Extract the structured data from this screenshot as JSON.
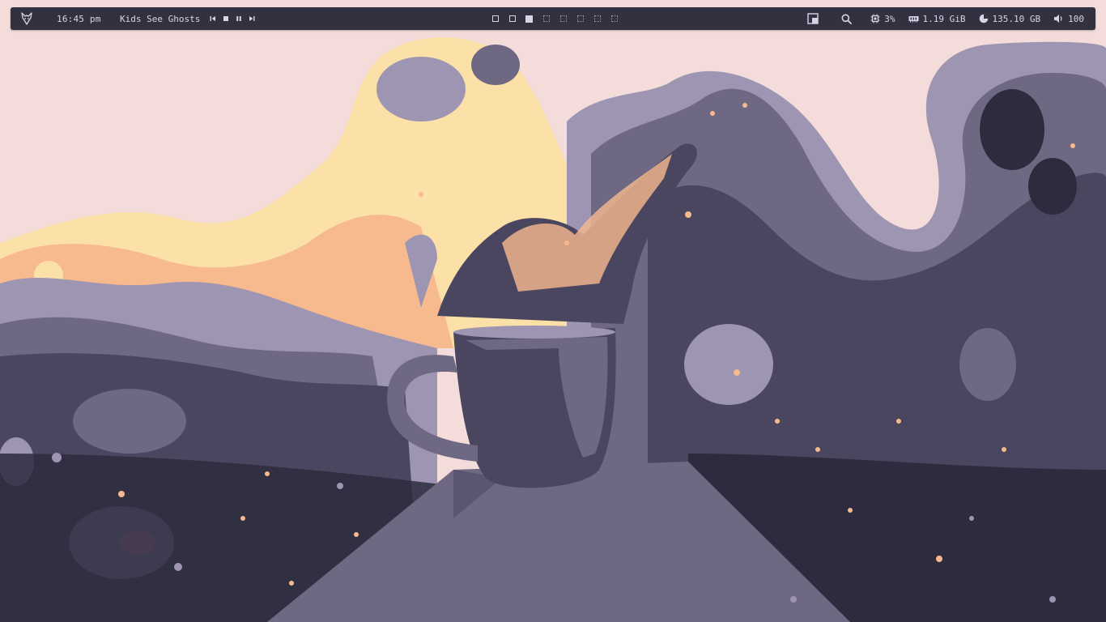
{
  "topbar": {
    "logo_icon": "wolf-logo-icon",
    "clock": "16:45 pm",
    "media": {
      "title": "Kids See Ghosts",
      "controls": [
        {
          "name": "previous",
          "icon": "skip-previous-icon"
        },
        {
          "name": "stop",
          "icon": "stop-icon"
        },
        {
          "name": "pause",
          "icon": "pause-icon"
        },
        {
          "name": "next",
          "icon": "skip-next-icon"
        }
      ]
    },
    "workspaces": [
      {
        "id": 1,
        "state": "occupied"
      },
      {
        "id": 2,
        "state": "occupied"
      },
      {
        "id": 3,
        "state": "active"
      },
      {
        "id": 4,
        "state": "empty"
      },
      {
        "id": 5,
        "state": "empty"
      },
      {
        "id": 6,
        "state": "empty"
      },
      {
        "id": 7,
        "state": "empty"
      },
      {
        "id": 8,
        "state": "empty"
      }
    ],
    "tools": [
      {
        "name": "layout",
        "icon": "window-layout-icon"
      },
      {
        "name": "search",
        "icon": "search-icon"
      }
    ],
    "stats": {
      "cpu": {
        "icon": "cpu-icon",
        "value": "3%"
      },
      "ram": {
        "icon": "memory-icon",
        "value": "1.19 GiB"
      },
      "disk": {
        "icon": "disk-usage-icon",
        "value": "135.10 GB"
      },
      "volume": {
        "icon": "speaker-icon",
        "value": "100"
      }
    }
  },
  "colors": {
    "bar_bg": "#32313f",
    "bar_fg": "#d8d4e8",
    "sky": "#f3dcd9",
    "peach": "#f7b98e",
    "cream": "#fbe1a8",
    "lavender": "#9d95b2",
    "purple_mid": "#6e6882",
    "purple_dark": "#4a4660",
    "shadow": "#2d2b3d"
  },
  "wallpaper": {
    "subject": "splashing-cup-wallpaper"
  }
}
